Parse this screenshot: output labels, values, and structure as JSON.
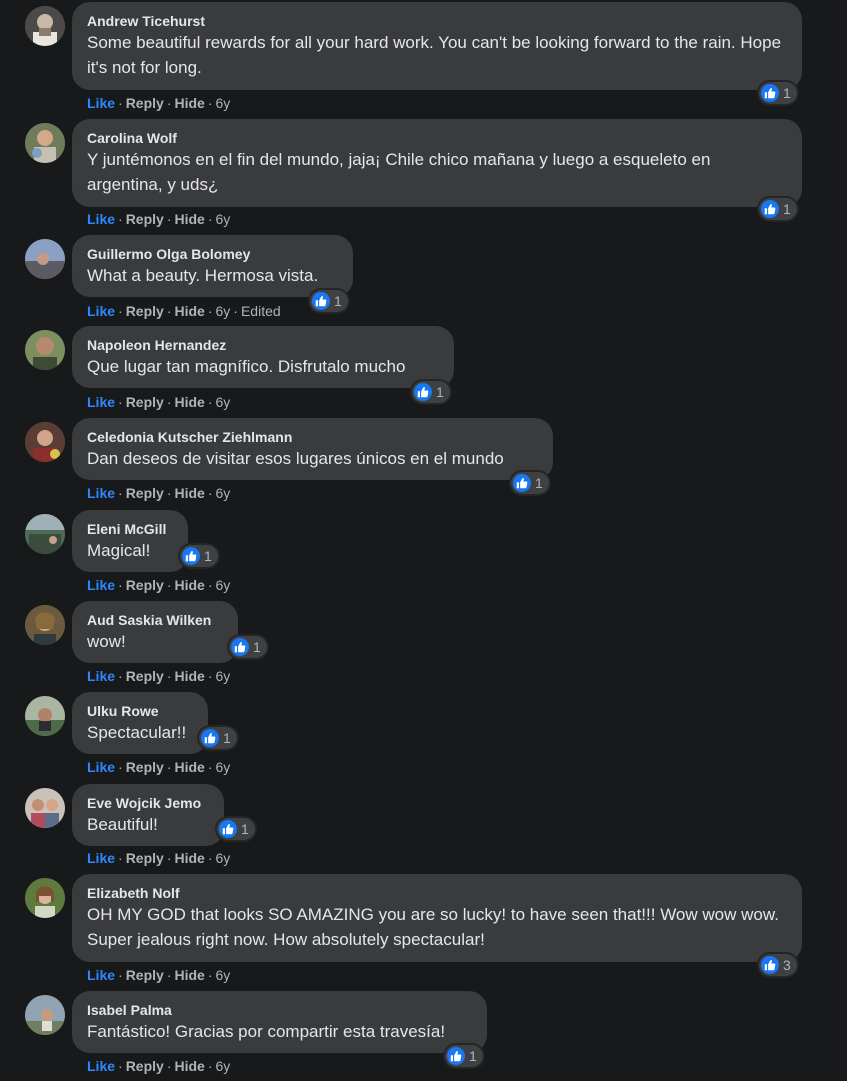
{
  "ui": {
    "like_label": "Like",
    "reply_label": "Reply",
    "hide_label": "Hide",
    "separator": "·",
    "edited_label": "Edited",
    "reaction_icon": "like-thumb-icon",
    "colors": {
      "background": "#18191a",
      "bubble": "#3a3b3c",
      "like_blue": "#2d88ff",
      "reaction_blue": "#1877f2",
      "secondary_text": "#b0b3b8",
      "primary_text": "#e4e6eb"
    }
  },
  "comments": [
    {
      "author": "Andrew Ticehurst",
      "text": "Some beautiful rewards for all your hard work. You can't be looking forward to the rain. Hope it's not for long.",
      "time": "6y",
      "edited": false,
      "reactions": "1"
    },
    {
      "author": "Carolina Wolf",
      "text": "Y juntémonos en el fin del mundo, jaja¡ Chile chico mañana y luego a esqueleto en argentina, y uds¿",
      "time": "6y",
      "edited": false,
      "reactions": "1"
    },
    {
      "author": "Guillermo Olga Bolomey",
      "text": "What a beauty. Hermosa vista.",
      "time": "6y",
      "edited": true,
      "reactions": "1"
    },
    {
      "author": "Napoleon Hernandez",
      "text": "Que lugar tan magnífico. Disfrutalo mucho",
      "time": "6y",
      "edited": false,
      "reactions": "1"
    },
    {
      "author": "Celedonia Kutscher Ziehlmann",
      "text": "Dan deseos de visitar esos lugares únicos en el mundo",
      "time": "6y",
      "edited": false,
      "reactions": "1"
    },
    {
      "author": "Eleni McGill",
      "text": "Magical!",
      "time": "6y",
      "edited": false,
      "reactions": "1"
    },
    {
      "author": "Aud Saskia Wilken",
      "text": "wow!",
      "time": "6y",
      "edited": false,
      "reactions": "1"
    },
    {
      "author": "Ulku Rowe",
      "text": "Spectacular!!",
      "time": "6y",
      "edited": false,
      "reactions": "1"
    },
    {
      "author": "Eve Wojcik Jemo",
      "text": "Beautiful!",
      "time": "6y",
      "edited": false,
      "reactions": "1"
    },
    {
      "author": "Elizabeth Nolf",
      "text": "OH MY GOD that looks SO AMAZING you are so lucky! to have seen that!!! Wow wow wow. Super jealous right now. How absolutely spectacular!",
      "time": "6y",
      "edited": false,
      "reactions": "3"
    },
    {
      "author": "Isabel Palma",
      "text": "Fantástico! Gracias por compartir esta travesía!",
      "time": "6y",
      "edited": false,
      "reactions": "1"
    }
  ]
}
